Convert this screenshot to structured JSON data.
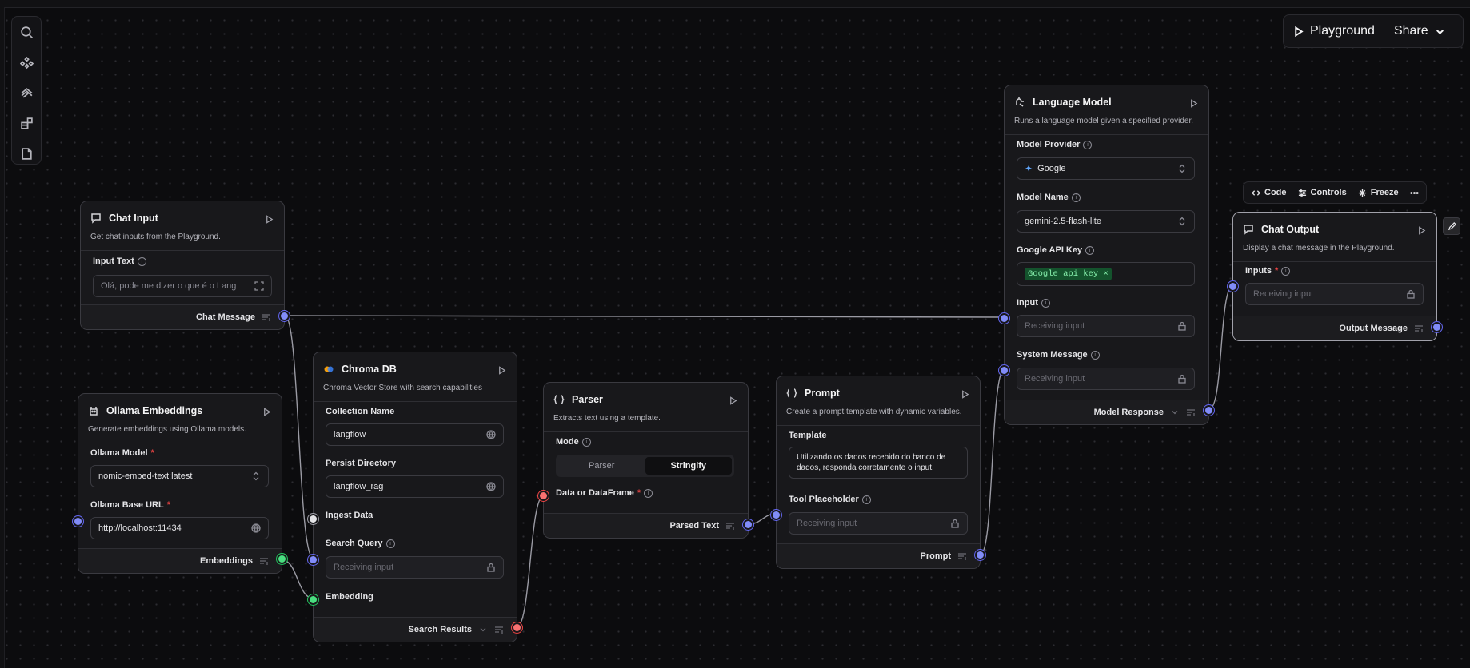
{
  "topbar": {
    "playground_label": "Playground",
    "share_label": "Share"
  },
  "node_toolbar": {
    "code_label": "Code",
    "controls_label": "Controls",
    "freeze_label": "Freeze"
  },
  "chat_input": {
    "title": "Chat Input",
    "description": "Get chat inputs from the Playground.",
    "input_text_label": "Input Text",
    "input_text_value": "Olá, pode me dizer o que é o Lang",
    "output_label": "Chat Message"
  },
  "ollama": {
    "title": "Ollama Embeddings",
    "description": "Generate embeddings using Ollama models.",
    "model_label": "Ollama Model",
    "model_value": "nomic-embed-text:latest",
    "base_url_label": "Ollama Base URL",
    "base_url_value": "http://localhost:11434",
    "output_label": "Embeddings"
  },
  "chroma": {
    "title": "Chroma DB",
    "description": "Chroma Vector Store with search capabilities",
    "collection_label": "Collection Name",
    "collection_value": "langflow",
    "persist_label": "Persist Directory",
    "persist_value": "langflow_rag",
    "ingest_label": "Ingest Data",
    "query_label": "Search Query",
    "query_placeholder": "Receiving input",
    "embedding_label": "Embedding",
    "output_label": "Search Results"
  },
  "parser": {
    "title": "Parser",
    "description": "Extracts text using a template.",
    "mode_label": "Mode",
    "mode_options": [
      "Parser",
      "Stringify"
    ],
    "mode_selected": "Stringify",
    "data_label": "Data or DataFrame",
    "output_label": "Parsed Text"
  },
  "prompt": {
    "title": "Prompt",
    "description": "Create a prompt template with dynamic variables.",
    "template_label": "Template",
    "template_value": "Utilizando os dados recebido do banco de dados, responda corretamente o input.",
    "tool_label": "Tool Placeholder",
    "tool_placeholder": "Receiving input",
    "output_label": "Prompt"
  },
  "language_model": {
    "title": "Language Model",
    "description": "Runs a language model given a specified provider.",
    "provider_label": "Model Provider",
    "provider_value": "Google",
    "model_name_label": "Model Name",
    "model_name_value": "gemini-2.5-flash-lite",
    "api_key_label": "Google API Key",
    "api_key_value": "Google_api_key",
    "input_label": "Input",
    "input_placeholder": "Receiving input",
    "system_label": "System Message",
    "system_placeholder": "Receiving input",
    "output_label": "Model Response"
  },
  "chat_output": {
    "title": "Chat Output",
    "description": "Display a chat message in the Playground.",
    "inputs_label": "Inputs",
    "inputs_placeholder": "Receiving input",
    "output_label": "Output Message"
  },
  "colors": {
    "canvas": "#0c0c0e",
    "node_bg": "#18181b",
    "handle_message": "#818cf8",
    "handle_embedding": "#4ade80",
    "handle_data": "#f87171",
    "api_key_tag": "#14532d"
  }
}
